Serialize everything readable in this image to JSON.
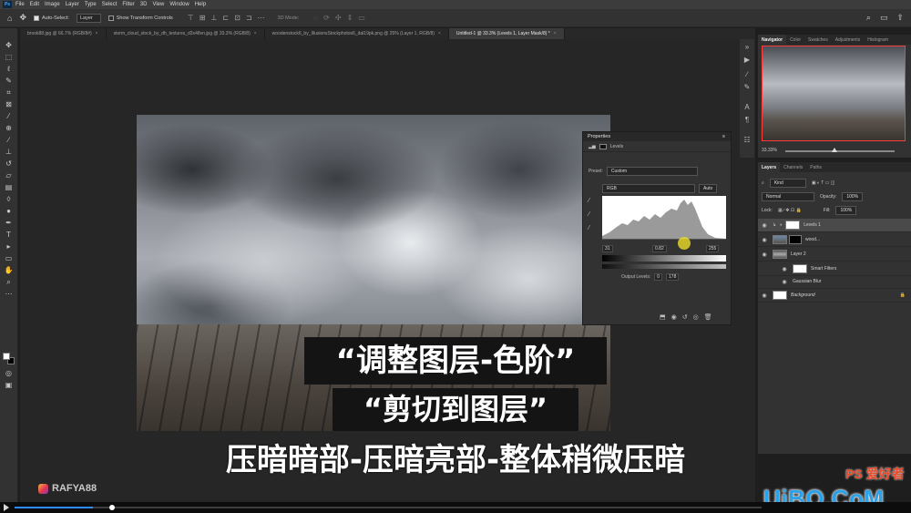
{
  "app": {
    "logo": "Ps"
  },
  "menu": [
    "File",
    "Edit",
    "Image",
    "Layer",
    "Type",
    "Select",
    "Filter",
    "3D",
    "View",
    "Window",
    "Help"
  ],
  "options": {
    "auto_select": "Auto-Select:",
    "target": "Layer",
    "show_transform": "Show Transform Controls",
    "mode_3d": "3D Mode:"
  },
  "tabs": [
    "brook88.jpg @ 66.7% (RGB/8#)",
    "storm_cloud_stock_by_dh_textures_d3x48vn.jpg @ 33.3% (RGB/8)",
    "woodenstock6_by_IllusionsStockphotos6_dal19pk.png @ 25% (Layer 1, RGB/8)",
    "Untitled-1 @ 33.3% (Levels 1, Layer Mask/8) *"
  ],
  "captions": {
    "line1": "“调整图层-色阶”",
    "line2": "“剪切到图层”",
    "line3": "压暗暗部-压暗亮部-整体稍微压暗"
  },
  "channel": "RAFYA88",
  "properties": {
    "title": "Properties",
    "subtitle": "Levels",
    "preset_label": "Preset:",
    "preset_value": "Custom",
    "channel": "RGB",
    "auto": "Auto",
    "input_black": "31",
    "input_gamma": "0.82",
    "input_white": "255",
    "output_label": "Output Levels:",
    "output_black": "0",
    "output_white": "178"
  },
  "navigator": {
    "tabs": [
      "Navigator",
      "Color",
      "Swatches",
      "Adjustments",
      "Histogram"
    ],
    "zoom": "33.33%",
    "zoom_level": 0.45
  },
  "layers": {
    "tabs": [
      "Layers",
      "Channels",
      "Paths"
    ],
    "kind": "Kind",
    "blend": "Normal",
    "opacity_label": "Opacity:",
    "opacity": "100%",
    "lock_label": "Lock:",
    "fill_label": "Fill:",
    "fill": "100%",
    "items": [
      {
        "name": "Levels 1",
        "selected": true
      },
      {
        "name": "wood..."
      },
      {
        "name": "Layer 2"
      },
      {
        "name": "Smart Filters"
      },
      {
        "name": "Gaussian Blur"
      },
      {
        "name": "Background"
      }
    ]
  },
  "video": {
    "progress": 0.13,
    "progress2": 0.105
  },
  "watermark": {
    "site": "UiBQ.CoM",
    "badge": "PS 爱好者"
  },
  "colors": {
    "accent": "#2e8bff",
    "panel": "#323232",
    "caption_bg": "#141414"
  }
}
